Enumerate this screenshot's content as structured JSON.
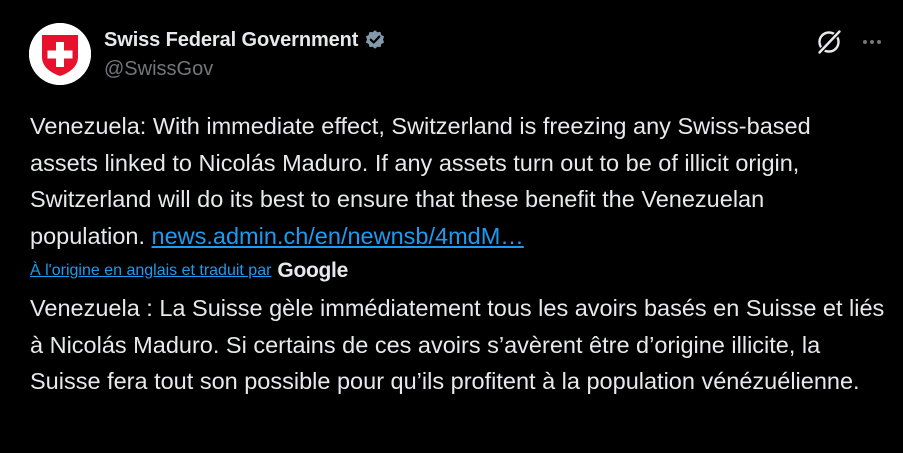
{
  "author": {
    "display_name": "Swiss Federal Government",
    "handle": "@SwissGov",
    "avatar_icon": "swiss-flag-icon",
    "verified_icon": "verified-badge-icon",
    "verified_color": "#829aab"
  },
  "actions": {
    "grok_icon": "grok-icon",
    "more_icon": "more-icon"
  },
  "tweet": {
    "text": "Venezuela: With immediate effect, Switzerland is freezing any Swiss-based assets linked to Nicolás Maduro. If any assets turn out to be of illicit origin, Switzerland will do its best to ensure that these benefit the Venezuelan population. ",
    "link": "news.admin.ch/en/newnsb/4mdM…"
  },
  "translation": {
    "label": "À l'origine en anglais et traduit par",
    "provider": "Google",
    "text": "Venezuela : La Suisse gèle immédiatement tous les avoirs basés en Suisse et liés à Nicolás Maduro. Si certains de ces avoirs s’avèrent être d’origine illicite, la Suisse fera tout son possible pour qu’ils profitent à la population vénézuélienne."
  },
  "colors": {
    "background": "#000000",
    "text": "#e7e9ea",
    "secondary": "#71767b",
    "link": "#1d9bf0",
    "swiss_red": "#e8112d"
  }
}
